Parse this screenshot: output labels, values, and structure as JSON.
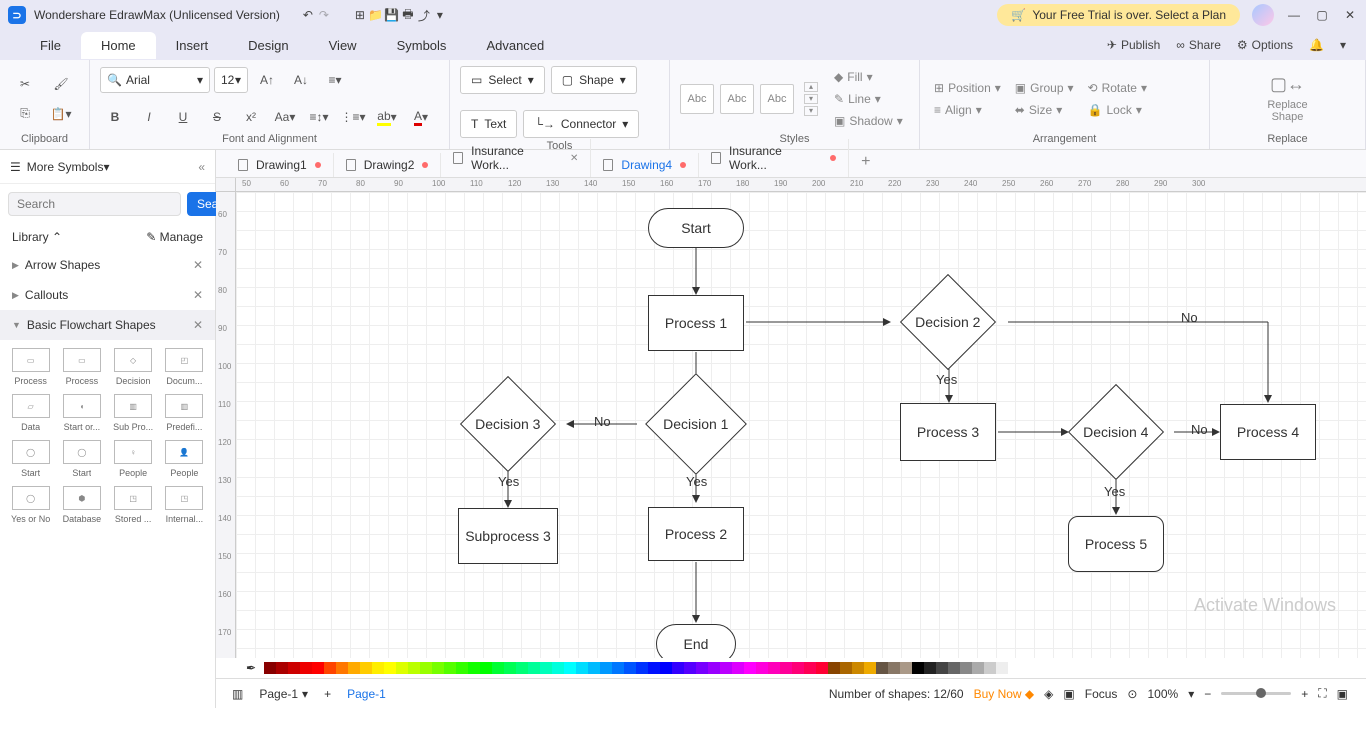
{
  "titlebar": {
    "app": "Wondershare EdrawMax (Unlicensed Version)",
    "trial": "Your Free Trial is over. Select a Plan"
  },
  "menu": {
    "items": [
      "File",
      "Home",
      "Insert",
      "Design",
      "View",
      "Symbols",
      "Advanced"
    ],
    "active": 1,
    "right": {
      "publish": "Publish",
      "share": "Share",
      "options": "Options"
    }
  },
  "ribbon": {
    "clipboard": "Clipboard",
    "font": "Font and Alignment",
    "tools": "Tools",
    "styles": "Styles",
    "arrangement": "Arrangement",
    "replace": "Replace",
    "font_name": "Arial",
    "font_size": "12",
    "select": "Select",
    "shape": "Shape",
    "text": "Text",
    "connector": "Connector",
    "abc": "Abc",
    "fill": "Fill",
    "line": "Line",
    "shadow": "Shadow",
    "position": "Position",
    "align": "Align",
    "group": "Group",
    "size": "Size",
    "rotate": "Rotate",
    "lock": "Lock",
    "replace_shape": "Replace\nShape"
  },
  "sidebar": {
    "more": "More Symbols",
    "search_ph": "Search",
    "search_btn": "Search",
    "library": "Library",
    "manage": "Manage",
    "cats": [
      "Arrow Shapes",
      "Callouts",
      "Basic Flowchart Shapes"
    ],
    "shapes": [
      "Process",
      "Process",
      "Decision",
      "Docum...",
      "Data",
      "Start or...",
      "Sub Pro...",
      "Predefi...",
      "Start",
      "Start",
      "People",
      "People",
      "Yes or No",
      "Database",
      "Stored ...",
      "Internal..."
    ]
  },
  "tabs": [
    {
      "label": "Drawing1",
      "mod": true
    },
    {
      "label": "Drawing2",
      "mod": true
    },
    {
      "label": "Insurance Work...",
      "close": true
    },
    {
      "label": "Drawing4",
      "mod": true,
      "active": true
    },
    {
      "label": "Insurance Work...",
      "mod": true
    }
  ],
  "ruler_h": [
    50,
    60,
    70,
    80,
    90,
    100,
    110,
    120,
    130,
    140,
    150,
    160,
    170,
    180,
    190,
    200,
    210,
    220,
    230,
    240,
    250,
    260,
    270,
    280,
    290,
    300
  ],
  "ruler_v": [
    60,
    70,
    80,
    90,
    100,
    110,
    120,
    130,
    140,
    150,
    160,
    170
  ],
  "flow": {
    "start": "Start",
    "p1": "Process 1",
    "d1": "Decision 1",
    "d2": "Decision 2",
    "d3": "Decision 3",
    "d4": "Decision 4",
    "p2": "Process 2",
    "p3": "Process 3",
    "p4": "Process 4",
    "p5": "Process 5",
    "sub3": "Subprocess 3",
    "end": "End",
    "yes": "Yes",
    "no": "No"
  },
  "status": {
    "page": "Page-1",
    "page_tab": "Page-1",
    "shapes": "Number of shapes: 12/60",
    "buy": "Buy Now",
    "focus": "Focus",
    "zoom": "100%"
  },
  "watermark": "Activate Windows"
}
